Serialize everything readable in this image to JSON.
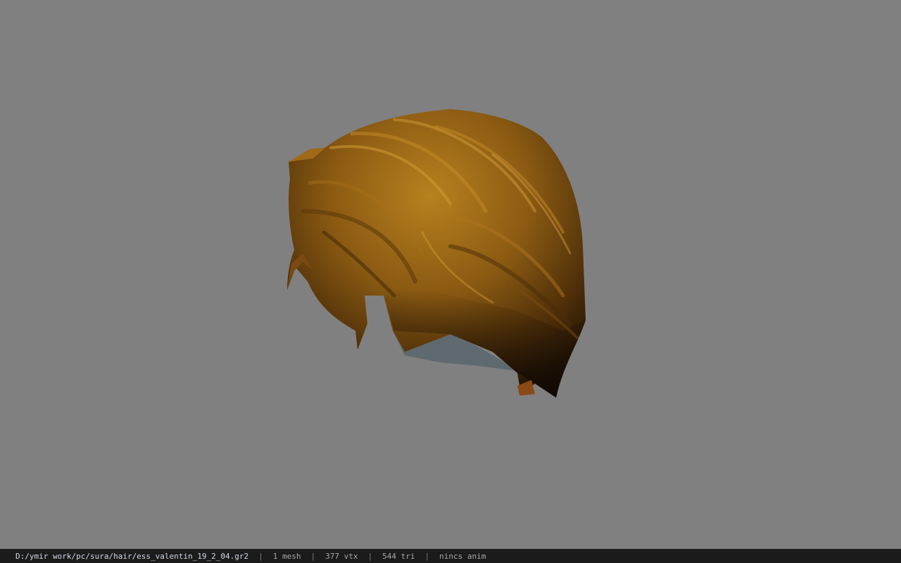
{
  "viewer": {
    "background_color": "#808080",
    "model_name": "hair-model"
  },
  "status_bar": {
    "file_path": "D:/ymir work/pc/sura/hair/ess_valentin_19_2_04.gr2",
    "separator": "|",
    "mesh_count": "1 mesh",
    "vertex_count": "377 vtx",
    "triangle_count": "544 tri",
    "anim_label": "nincs anim"
  }
}
